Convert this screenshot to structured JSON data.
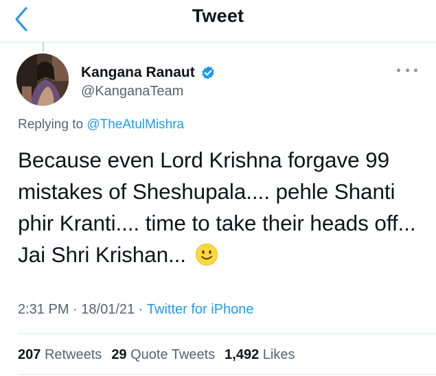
{
  "header": {
    "title": "Tweet"
  },
  "tweet": {
    "author": {
      "name": "Kangana Ranaut",
      "handle": "@KanganaTeam",
      "verified": true
    },
    "reply": {
      "prefix": "Replying to ",
      "mention": "@TheAtulMishra"
    },
    "text": "Because even Lord Krishna forgave 99 mistakes of Sheshupala.... pehle Shanti phir Kranti.... time to take their heads off... Jai Shri Krishan...",
    "emoji": "slightly-smiling-face",
    "time": "2:31 PM",
    "date": "18/01/21",
    "separator": " · ",
    "source": "Twitter for iPhone"
  },
  "stats": {
    "retweets": {
      "count": "207",
      "label": "Retweets"
    },
    "quotes": {
      "count": "29",
      "label": "Quote Tweets"
    },
    "likes": {
      "count": "1,492",
      "label": "Likes"
    }
  },
  "colors": {
    "accent": "#1d9bf0",
    "secondary_text": "#536471",
    "primary_text": "#0f1419",
    "divider": "#e1e6ea",
    "emoji_fill": "#ffd93b"
  },
  "icons": {
    "back": "chevron-left-icon",
    "verified": "verified-badge-icon",
    "more": "more-horizontal-icon"
  }
}
